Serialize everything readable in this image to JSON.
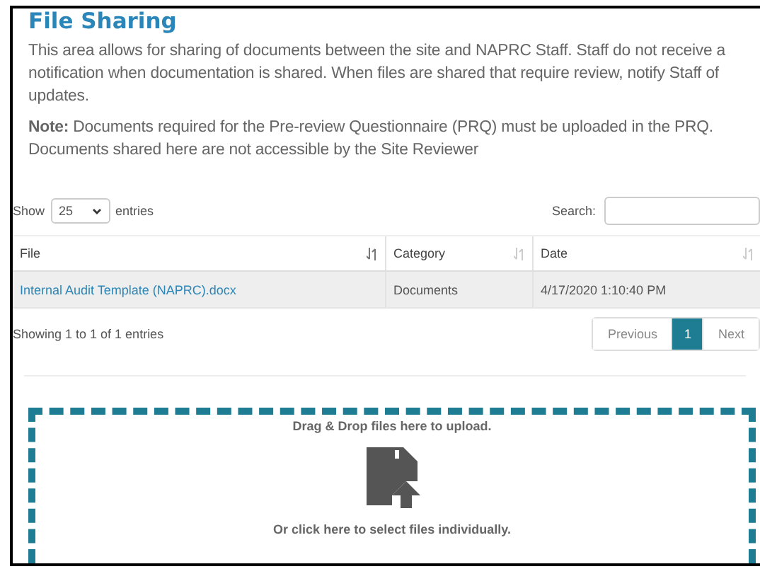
{
  "title": "File Sharing",
  "intro": "This area allows for sharing of documents between the site and NAPRC Staff. Staff do not receive a notification when documentation is shared.  When files are shared that require review, notify Staff of updates.",
  "note": "**Note:** Documents required for the Pre-review Questionnaire (PRQ) must be uploaded in the PRQ. Documents shared here are not accessible by the Site Reviewer",
  "length": {
    "prefix": "Show",
    "value": "25",
    "suffix": "entries"
  },
  "search": {
    "label": "Search:"
  },
  "table": {
    "columns": [
      {
        "label": "File",
        "sorted": true
      },
      {
        "label": "Category",
        "sorted": false
      },
      {
        "label": "Date",
        "sorted": false
      }
    ],
    "rows": [
      {
        "cells": [
          "Internal Audit Template (NAPRC).docx",
          "Documents",
          "4/17/2020 1:10:40 PM"
        ]
      }
    ]
  },
  "info": "Showing 1 to 1 of 1 entries",
  "pagination": [
    {
      "label": "Previous",
      "selected": false
    },
    {
      "label": "1",
      "selected": true
    },
    {
      "label": "Next",
      "selected": false
    }
  ],
  "dropzone": {
    "top": "Drag & Drop files here to upload.",
    "bottom": "Or click here to select files individually."
  }
}
